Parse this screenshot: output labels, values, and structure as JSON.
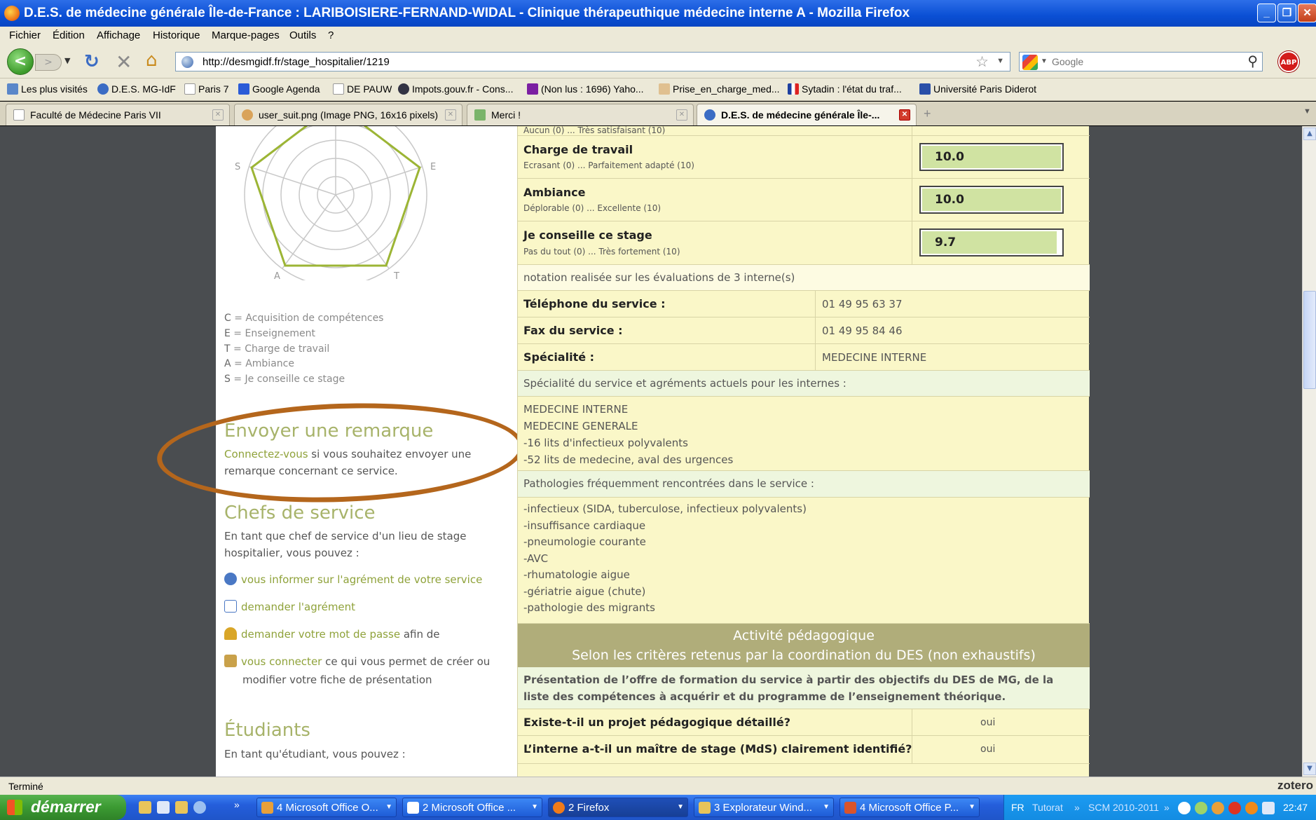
{
  "window": {
    "title": "D.E.S. de médecine générale Île-de-France : LARIBOISIERE-FERNAND-WIDAL - Clinique thérapeuthique médecine interne A - Mozilla Firefox"
  },
  "menu": [
    "Fichier",
    "Édition",
    "Affichage",
    "Historique",
    "Marque-pages",
    "Outils",
    "?"
  ],
  "nav": {
    "url": "http://desmgidf.fr/stage_hospitalier/1219",
    "search_placeholder": "Google",
    "abp": "ABP"
  },
  "bookmarks": [
    "Les plus visités",
    "D.E.S. MG-IdF",
    "Paris 7",
    "Google Agenda",
    "DE PAUW",
    "Impots.gouv.fr - Cons...",
    "(Non lus : 1696) Yaho...",
    "Prise_en_charge_med...",
    "Sytadin : l'état du traf...",
    "Université Paris Diderot"
  ],
  "tabs": [
    "Faculté de Médecine Paris VII",
    "user_suit.png (Image PNG, 16x16 pixels)",
    "Merci !",
    "D.E.S. de médecine générale Île-..."
  ],
  "left": {
    "radar_axes": [
      "S",
      "E",
      "T",
      "A"
    ],
    "legend": [
      {
        "key": "C",
        "text": " = Acquisition de compétences"
      },
      {
        "key": "E",
        "text": " = Enseignement"
      },
      {
        "key": "T",
        "text": " = Charge de travail"
      },
      {
        "key": "A",
        "text": " = Ambiance"
      },
      {
        "key": "S",
        "text": " = Je conseille ce stage"
      }
    ],
    "remarque": {
      "title": "Envoyer une remarque",
      "link": "Connectez-vous",
      "text1": " si vous souhaitez envoyer une",
      "text2": "remarque concernant ce service."
    },
    "chefs": {
      "title": "Chefs de service",
      "intro1": "En tant que chef de service d'un lieu de stage",
      "intro2": "hospitalier, vous pouvez :",
      "item1": "vous informer sur l'agrément de votre service",
      "item2": "demander l'agrément",
      "item3_link": "demander votre mot de passe",
      "item3_rest": " afin de",
      "item4_link": "vous connecter",
      "item4_rest": " ce qui vous permet de créer ou",
      "item4_cont": "modifier votre fiche de présentation"
    },
    "etudiants": {
      "title": "Étudiants",
      "intro": "En tant qu'étudiant, vous pouvez :"
    }
  },
  "table": {
    "top_partial": "Aucun (0) ... Très satisfaisant (10)",
    "scores": [
      {
        "label": "Charge de travail",
        "scale": "Ecrasant (0) ... Parfaitement adapté (10)",
        "value": "10.0",
        "level": 1.0
      },
      {
        "label": "Ambiance",
        "scale": "Déplorable (0) ... Excellente (10)",
        "value": "10.0",
        "level": 1.0
      },
      {
        "label": "Je conseille ce stage",
        "scale": "Pas du tout (0) ... Très fortement (10)",
        "value": "9.7",
        "level": 0.97
      }
    ],
    "notation": "notation realisée sur les évaluations de 3 interne(s)",
    "telephone_label": "Téléphone du service :",
    "telephone_value": "01 49 95 63 37",
    "fax_label": "Fax du service :",
    "fax_value": "01 49 95 84 46",
    "specialite_label": "Spécialité :",
    "specialite_value": "MEDECINE INTERNE",
    "agrements_header": "Spécialité du service et agréments actuels pour les internes :",
    "agrements": [
      "MEDECINE INTERNE",
      "MEDECINE GENERALE",
      "-16 lits d'infectieux polyvalents",
      "-52 lits de medecine, aval des urgences"
    ],
    "pathologies_header": "Pathologies fréquemment rencontrées dans le service :",
    "pathologies": [
      "-infectieux (SIDA, tuberculose, infectieux polyvalents)",
      "-insuffisance cardiaque",
      "-pneumologie courante",
      "-AVC",
      "-rhumatologie aigue",
      "-gériatrie aigue (chute)",
      "-pathologie des migrants"
    ],
    "banner1": "Activité pédagogique",
    "banner2": "Selon les critères retenus par la coordination du DES (non exhaustifs)",
    "presentation1": "Présentation de l’offre de formation du service à partir des objectifs du DES de MG, de la",
    "presentation2": "liste des compétences à acquérir et du programme de l’enseignement théorique.",
    "q1": "Existe-t-il un projet pédagogique détaillé?",
    "q1_answer": "oui",
    "q2": "L’interne a-t-il un maître de stage (MdS) clairement identifié?",
    "q2_answer": "oui"
  },
  "status": {
    "text": "Terminé",
    "zotero": "zotero"
  },
  "taskbar": {
    "start": "démarrer",
    "buttons": [
      "4 Microsoft Office O...",
      "2 Microsoft Office ...",
      "2 Firefox",
      "3 Explorateur Wind...",
      "4 Microsoft Office P..."
    ],
    "lang": "FR",
    "tutorat": "Tutorat",
    "scm": "SCM 2010-2011",
    "clock": "22:47"
  }
}
